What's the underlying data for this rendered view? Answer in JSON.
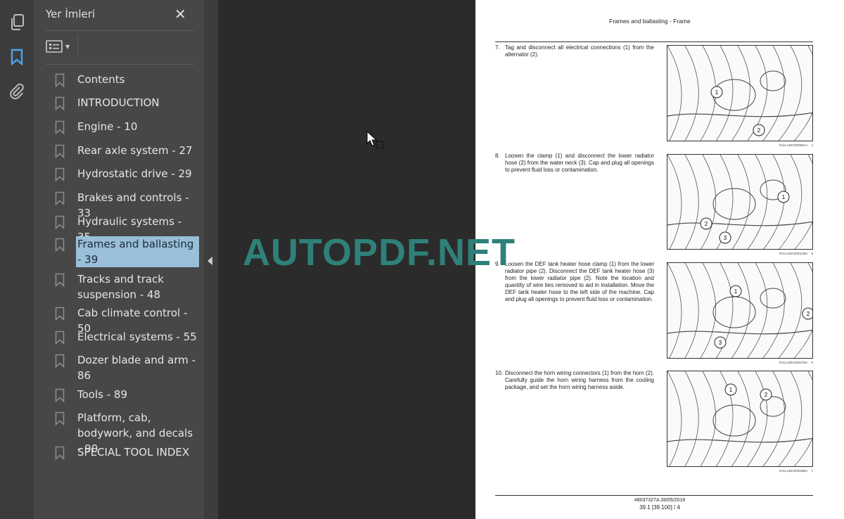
{
  "sidebar": {
    "title": "Yer İmleri",
    "close_icon": "close-icon",
    "rail_icons": [
      "pages-icon",
      "bookmark-icon",
      "attachment-icon"
    ],
    "active_color": "#4aa3ee",
    "bookmarks": [
      {
        "label": "Contents"
      },
      {
        "label": "INTRODUCTION"
      },
      {
        "label": "Engine - 10"
      },
      {
        "label": "Rear axle system - 27"
      },
      {
        "label": "Hydrostatic drive - 29"
      },
      {
        "label": "Brakes and controls - 33"
      },
      {
        "label": "Hydraulic systems - 35"
      },
      {
        "label": "Frames and ballasting - 39",
        "selected": true
      },
      {
        "label": "Tracks and track suspension - 48"
      },
      {
        "label": "Cab climate control - 50"
      },
      {
        "label": "Electrical systems - 55"
      },
      {
        "label": "Dozer blade and arm - 86"
      },
      {
        "label": "Tools - 89"
      },
      {
        "label": "Platform, cab, bodywork, and decals - 90"
      },
      {
        "label": "SPECIAL TOOL INDEX"
      }
    ]
  },
  "page": {
    "header": "Frames and ballasting - Frame",
    "steps": [
      {
        "num": "7.",
        "text": "Tag and disconnect all electrical connections (1) from the alternator (2).",
        "caption": "RAIL14DOZ0089AA",
        "fig": "4"
      },
      {
        "num": "8.",
        "text": "Loosen the clamp (1) and disconnect the lower radiator hose (2) from the water neck (3).  Cap and plug all openings to prevent fluid loss or contamination.",
        "caption": "RAIL14DOZ0012BA",
        "fig": "5"
      },
      {
        "num": "9.",
        "text": "Loosen the DEF tank heater hose clamp (1) from the lower radiator pipe (2). Disconnect the DEF tank heater hose (3) from the lower radiator pipe (2).  Note the location and quantity of wire ties removed to aid in installation.  Move the DEF tank heater hose to the left side of the machine.  Cap and plug all openings to prevent fluid loss or contamination.",
        "caption": "RAIL14DOZ0047BA",
        "fig": "6"
      },
      {
        "num": "10.",
        "text": "Disconnect the horn wiring connectors (1) from the horn (2). Carefully guide the horn wiring harness from the cooling package, and set the horn wiring harness aside.",
        "caption": "RAIL14DOZ0048BA",
        "fig": "7"
      }
    ],
    "footer_doc": "48037327A 28/05/2018",
    "footer_page": "39.1 [39.100] / 4"
  },
  "watermark": "AUTOPDF.NET",
  "watermark_color": "#2f8079"
}
